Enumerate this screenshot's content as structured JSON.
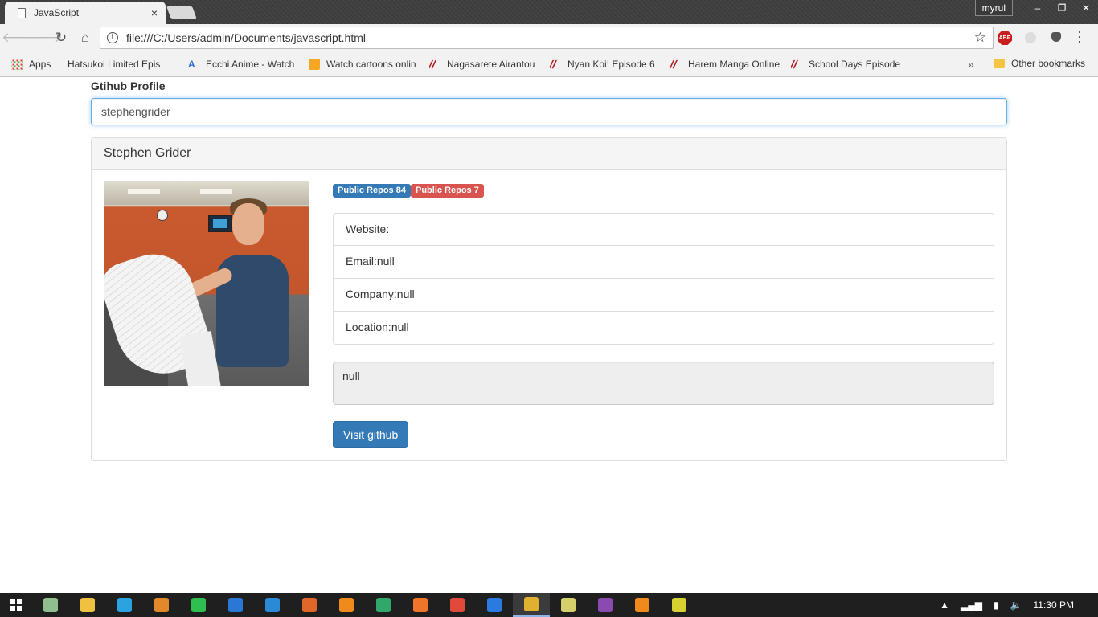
{
  "browser": {
    "tab_title": "JavaScript",
    "tab_close": "×",
    "profile_name": "myrul",
    "window_controls": [
      "–",
      "❐",
      "✕"
    ],
    "address": "file:///C:/Users/admin/Documents/javascript.html",
    "abp_label": "ABP",
    "bookmarks": [
      {
        "label": "Apps",
        "icon": "apps-grid-icon"
      },
      {
        "label": "Hatsukoi Limited Epis",
        "icon": "page-icon"
      },
      {
        "label": "Ecchi Anime - Watch",
        "icon": "anime-icon"
      },
      {
        "label": "Watch cartoons onlin",
        "icon": "cartoon-icon"
      },
      {
        "label": "Nagasarete Airantou",
        "icon": "slash-icon"
      },
      {
        "label": "Nyan Koi! Episode 6 ",
        "icon": "slash-icon"
      },
      {
        "label": "Harem Manga Online",
        "icon": "slash-icon"
      },
      {
        "label": "School Days Episode",
        "icon": "slash-icon"
      }
    ],
    "bookmarks_more": "»",
    "other_bookmarks": "Other bookmarks"
  },
  "page": {
    "search_label": "Gtihub Profile",
    "search_value": "stephengrider",
    "profile_name": "Stephen Grider",
    "badges": {
      "repos_label": "Public Repos 84",
      "gists_label": "Public Repos 7"
    },
    "details": [
      {
        "text": "Website:"
      },
      {
        "text": "Email:null"
      },
      {
        "text": "Company:null"
      },
      {
        "text": "Location:null"
      }
    ],
    "bio": "null",
    "visit_button": "Visit github"
  },
  "taskbar": {
    "apps": [
      {
        "icon": "network-icon",
        "color": "#8fbf8f"
      },
      {
        "icon": "file-explorer-icon",
        "color": "#f0c040"
      },
      {
        "icon": "telegram-icon",
        "color": "#2aa3de"
      },
      {
        "icon": "app-orange-icon",
        "color": "#e0882a"
      },
      {
        "icon": "whatsapp-icon",
        "color": "#2fbf4f"
      },
      {
        "icon": "app-blue-icon",
        "color": "#2a78d6"
      },
      {
        "icon": "vscode-icon",
        "color": "#2a8ad6"
      },
      {
        "icon": "firefox-icon",
        "color": "#e0662a"
      },
      {
        "icon": "sublime-icon",
        "color": "#f08a1a"
      },
      {
        "icon": "app-green-icon",
        "color": "#2fa86a"
      },
      {
        "icon": "xampp-icon",
        "color": "#f0742a"
      },
      {
        "icon": "app-red-icon",
        "color": "#e04a3a"
      },
      {
        "icon": "firefox-dev-icon",
        "color": "#2a7ae0"
      },
      {
        "icon": "chrome-icon",
        "color": "#e0b030"
      },
      {
        "icon": "files-icon",
        "color": "#d6d06a"
      },
      {
        "icon": "winrar-icon",
        "color": "#8a4ab0"
      },
      {
        "icon": "sublime-alt-icon",
        "color": "#f08a1a"
      },
      {
        "icon": "media-icon",
        "color": "#d6d030"
      }
    ],
    "time": "11:30 PM"
  },
  "colors": {
    "primary": "#337ab7",
    "danger": "#d9534f",
    "focus": "#66afe9"
  }
}
